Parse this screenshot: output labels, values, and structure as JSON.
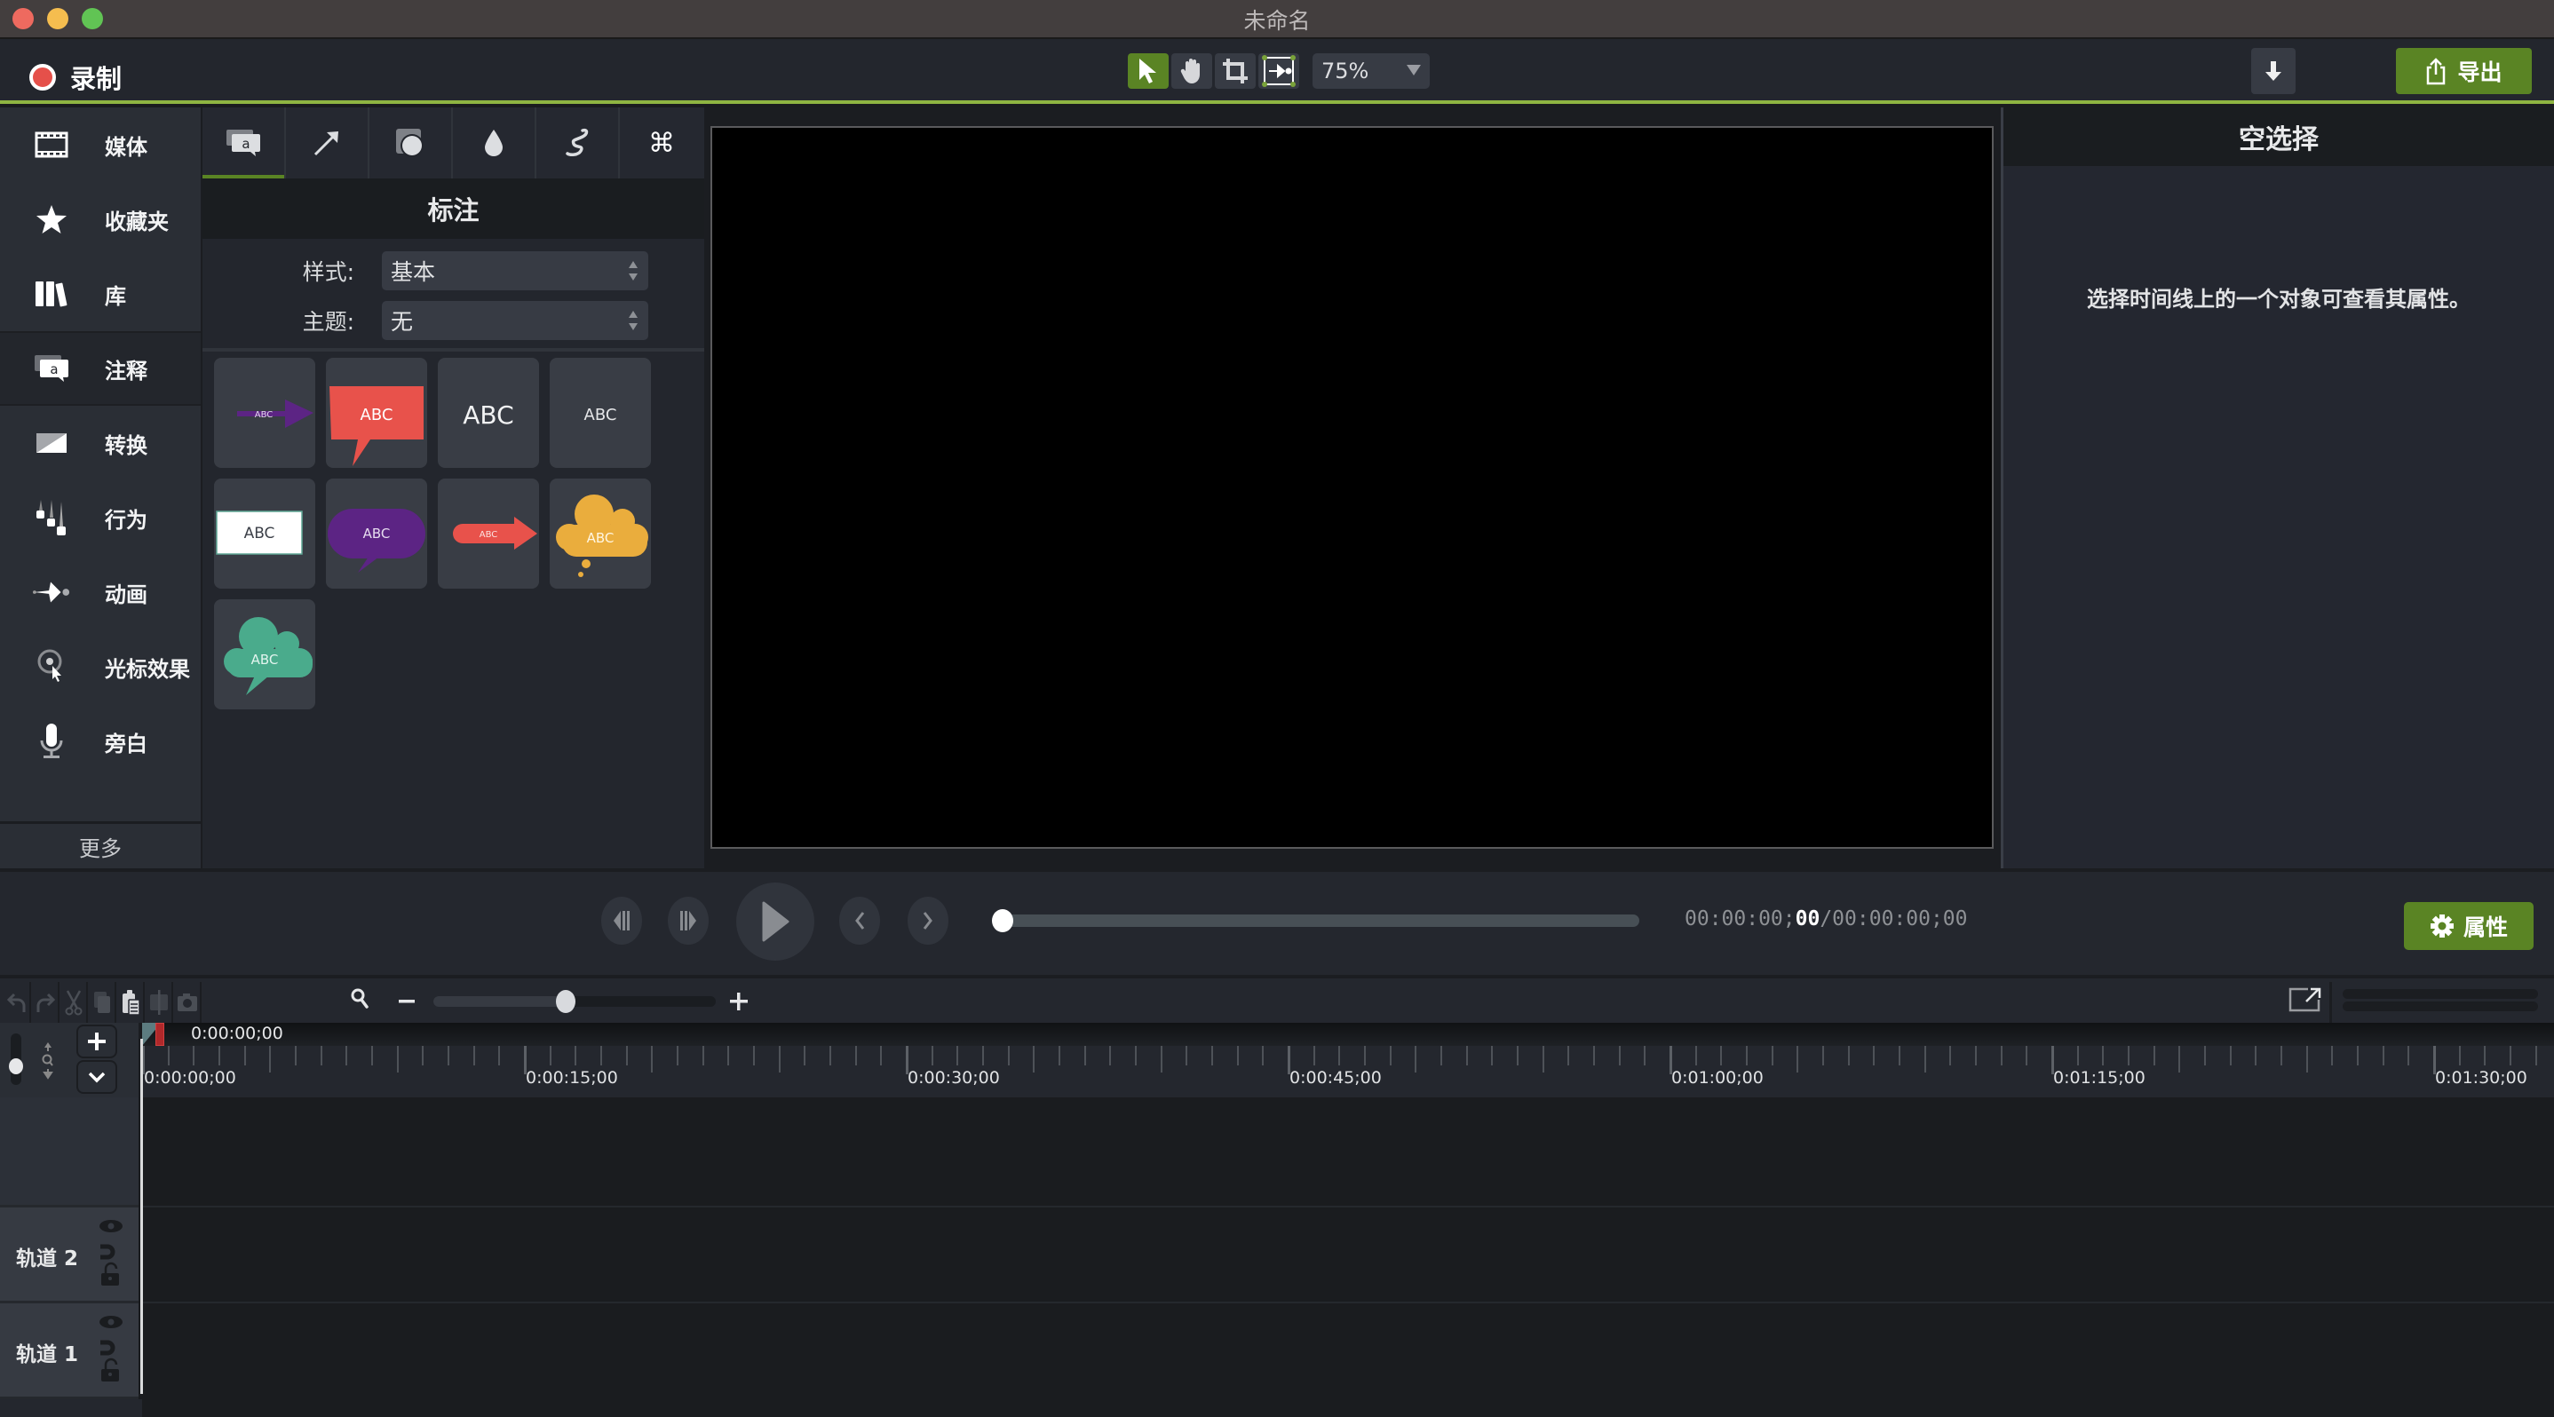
{
  "window": {
    "title": "未命名",
    "traffic_lights": {
      "close": "#ee6a5f",
      "minimize": "#f5bd4f",
      "maximize": "#61c454"
    }
  },
  "toolbar": {
    "record_label": "录制",
    "tools": [
      {
        "name": "select-tool",
        "icon": "arrow-pointer-icon",
        "active": true
      },
      {
        "name": "pan-tool",
        "icon": "hand-icon",
        "active": false
      },
      {
        "name": "crop-tool",
        "icon": "crop-icon",
        "active": false
      },
      {
        "name": "fit-tool",
        "icon": "resize-icon",
        "active": false
      }
    ],
    "zoom_value": "75%",
    "download_icon": "arrow-down-icon",
    "export_label": "导出",
    "accent": "#5a8424"
  },
  "sidebar": {
    "items": [
      {
        "label": "媒体",
        "icon": "film-icon",
        "active": false
      },
      {
        "label": "收藏夹",
        "icon": "star-icon",
        "active": false
      },
      {
        "label": "库",
        "icon": "library-icon",
        "active": false
      },
      {
        "label": "注释",
        "icon": "annotation-icon",
        "active": true
      },
      {
        "label": "转换",
        "icon": "transition-icon",
        "active": false
      },
      {
        "label": "行为",
        "icon": "behavior-icon",
        "active": false
      },
      {
        "label": "动画",
        "icon": "animation-icon",
        "active": false
      },
      {
        "label": "光标效果",
        "icon": "cursor-effect-icon",
        "active": false
      },
      {
        "label": "旁白",
        "icon": "microphone-icon",
        "active": false
      }
    ],
    "more_label": "更多"
  },
  "annotations": {
    "tabs": [
      {
        "icon": "callout-icon",
        "active": true
      },
      {
        "icon": "arrow-line-icon",
        "active": false
      },
      {
        "icon": "shape-icon",
        "active": false
      },
      {
        "icon": "blur-drop-icon",
        "active": false
      },
      {
        "icon": "sketch-motion-icon",
        "active": false
      },
      {
        "icon": "keystroke-icon",
        "active": false
      }
    ],
    "title": "标注",
    "style_label": "样式:",
    "style_value": "基本",
    "theme_label": "主题:",
    "theme_value": "无",
    "tiles": [
      {
        "text": "ABC",
        "kind": "arrow-purple"
      },
      {
        "text": "ABC",
        "kind": "speech-red"
      },
      {
        "text": "ABC",
        "kind": "text-large"
      },
      {
        "text": "ABC",
        "kind": "text-small"
      },
      {
        "text": "ABC",
        "kind": "box-white"
      },
      {
        "text": "ABC",
        "kind": "speech-purple"
      },
      {
        "text": "ABC",
        "kind": "arrow-red"
      },
      {
        "text": "ABC",
        "kind": "thought-yellow"
      },
      {
        "text": "ABC",
        "kind": "cloud-green"
      }
    ]
  },
  "properties_panel": {
    "title": "空选择",
    "message": "选择时间线上的一个对象可查看其属性。"
  },
  "playback": {
    "progress": 0,
    "time_current_prefix": "00:00:00;",
    "time_current_frames": "00",
    "time_total": "/00:00:00;00",
    "properties_label": "属性"
  },
  "timeline": {
    "playhead_time": "0:00:00;00",
    "zoom_slider_fraction": 0.47,
    "ruler_labels": [
      "0:00:00;00",
      "0:00:15;00",
      "0:00:30;00",
      "0:00:45;00",
      "0:01:00;00",
      "0:01:15;00",
      "0:01:30;00"
    ],
    "tracks": [
      {
        "label": "轨道 2"
      },
      {
        "label": "轨道 1"
      }
    ]
  }
}
